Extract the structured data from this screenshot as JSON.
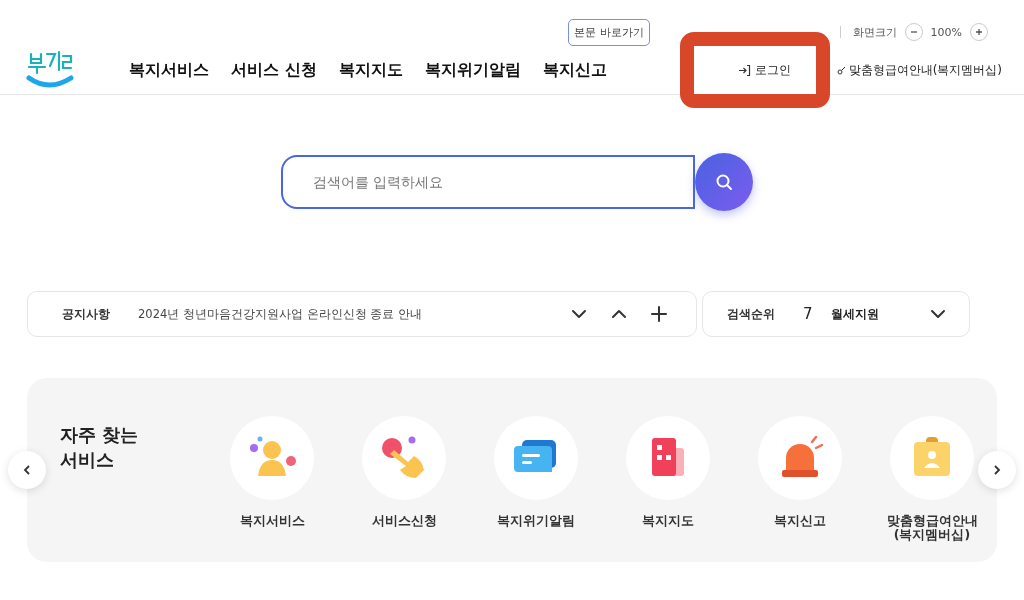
{
  "utility_bar": {
    "skip_link": "본문 바로가기",
    "zoom_label": "화면크기",
    "zoom_value": "100%"
  },
  "header": {
    "nav": [
      "복지서비스",
      "서비스 신청",
      "복지지도",
      "복지위기알림",
      "복지신고"
    ],
    "login": "로그인",
    "membership": "맞춤형급여안내(복지멤버십)"
  },
  "search": {
    "placeholder": "검색어를 입력하세요"
  },
  "notice": {
    "label": "공지사항",
    "text": "2024년 청년마음건강지원사업 온라인신청 종료 안내"
  },
  "ranking": {
    "label": "검색순위",
    "rank": "7",
    "term": "월세지원"
  },
  "services": {
    "title": "자주 찾는\n서비스",
    "items": [
      {
        "kind": "person",
        "label": "복지서비스"
      },
      {
        "kind": "hand",
        "label": "서비스신청"
      },
      {
        "kind": "chat",
        "label": "복지위기알림"
      },
      {
        "kind": "building",
        "label": "복지지도"
      },
      {
        "kind": "siren",
        "label": "복지신고"
      },
      {
        "kind": "card",
        "label": "맞춤형급여안내\n(복지멤버십)"
      }
    ]
  }
}
